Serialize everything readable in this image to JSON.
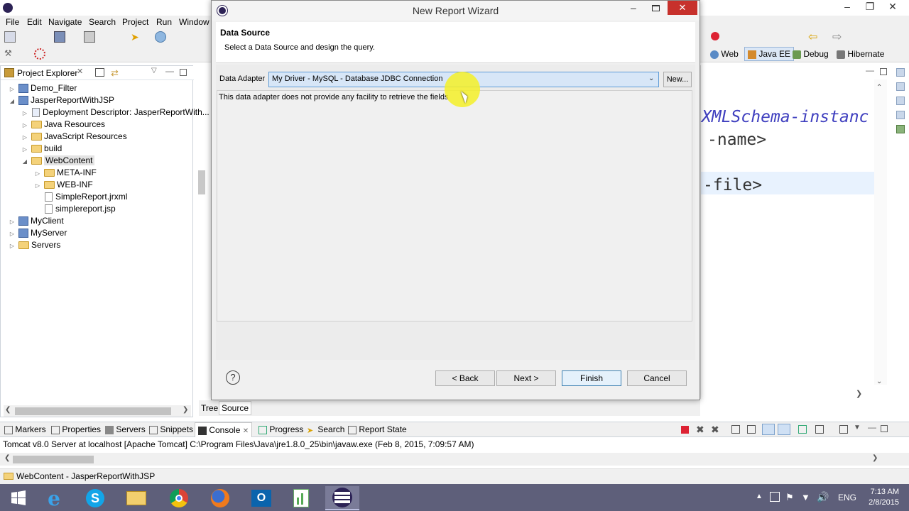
{
  "eclipse": {
    "menu": [
      "File",
      "Edit",
      "Navigate",
      "Search",
      "Project",
      "Run",
      "Window"
    ],
    "perspectives": [
      "Web",
      "Java EE",
      "Debug",
      "Hibernate"
    ],
    "project_explorer": {
      "title": "Project Explorer",
      "items": [
        {
          "label": "Demo_Filter"
        },
        {
          "label": "JasperReportWithJSP"
        },
        {
          "label": "Deployment Descriptor: JasperReportWith..."
        },
        {
          "label": "Java Resources"
        },
        {
          "label": "JavaScript Resources"
        },
        {
          "label": "build"
        },
        {
          "label": "WebContent"
        },
        {
          "label": "META-INF"
        },
        {
          "label": "WEB-INF"
        },
        {
          "label": "SimpleReport.jrxml"
        },
        {
          "label": "simplereport.jsp"
        },
        {
          "label": "MyClient"
        },
        {
          "label": "MyServer"
        },
        {
          "label": "Servers"
        }
      ]
    },
    "editor_lines": [
      "XMLSchema-instanc",
      "-name>",
      "-file>"
    ],
    "editor_tabs": [
      "Tree",
      "Source"
    ],
    "bottom_tabs": [
      "Markers",
      "Properties",
      "Servers",
      "Snippets",
      "Console",
      "Progress",
      "Search",
      "Report State"
    ],
    "console_text": "Tomcat v8.0 Server at localhost [Apache Tomcat] C:\\Program Files\\Java\\jre1.8.0_25\\bin\\javaw.exe (Feb 8, 2015, 7:09:57 AM)",
    "status_text": "WebContent - JasperReportWithJSP"
  },
  "dialog": {
    "title": "New Report Wizard",
    "heading": "Data Source",
    "description": "Select a Data Source and design the query.",
    "adapter_label": "Data Adapter",
    "adapter_value": "My Driver - MySQL - Database JDBC Connection",
    "new_button": "New...",
    "message": "This data adapter does not provide any facility to retrieve the fields",
    "help_symbol": "?",
    "buttons": {
      "back": "< Back",
      "next": "Next >",
      "finish": "Finish",
      "cancel": "Cancel"
    }
  },
  "taskbar": {
    "language": "ENG",
    "time": "7:13 AM",
    "date": "2/8/2015"
  },
  "colors": {
    "accent": "#3399ff",
    "taskbar": "#5e5f7a",
    "code": "#3f3fbf"
  }
}
